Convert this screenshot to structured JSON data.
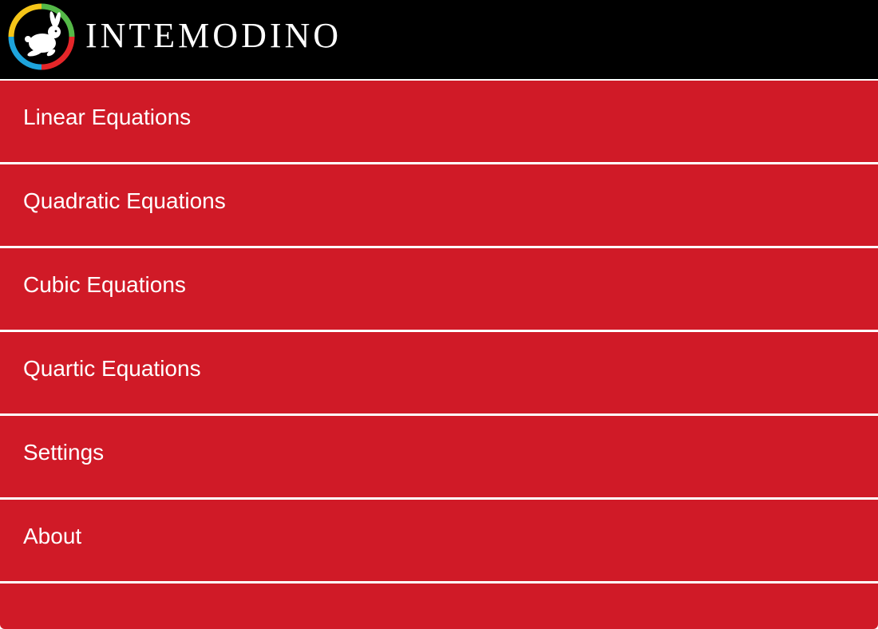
{
  "app": {
    "brand_name": "INTEMODINO",
    "logo_icon": "rabbit-logo-icon"
  },
  "menu": {
    "items": [
      {
        "label": "Linear Equations"
      },
      {
        "label": "Quadratic Equations"
      },
      {
        "label": "Cubic Equations"
      },
      {
        "label": "Quartic Equations"
      },
      {
        "label": "Settings"
      },
      {
        "label": "About"
      }
    ]
  },
  "colors": {
    "header_background": "#000000",
    "menu_item_background": "#d01a27",
    "separator": "#ffffff",
    "text": "#ffffff",
    "logo_ring_yellow": "#f5c518",
    "logo_ring_green": "#55b948",
    "logo_ring_blue": "#1ea4dc",
    "logo_ring_red": "#e52629"
  }
}
